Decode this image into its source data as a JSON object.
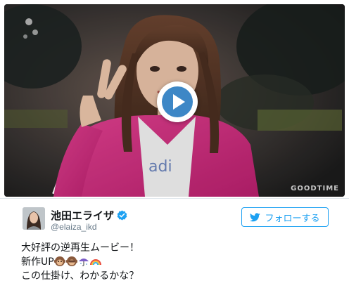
{
  "video": {
    "watermark": "GOODTIME",
    "play_icon": "play-icon"
  },
  "tweet": {
    "display_name": "池田エライザ",
    "verified_icon": "verified-badge-icon",
    "handle": "@elaiza_ikd",
    "follow_label": "フォローする",
    "follow_icon": "twitter-bird-icon",
    "lines": [
      "大好評の逆再生ムービー！",
      "新作UP",
      "この仕掛け、わかるかな？"
    ],
    "line2_emojis": [
      "monkey-face-icon",
      "monkey-face-icon",
      "umbrella-icon",
      "rainbow-icon"
    ]
  },
  "colors": {
    "accent": "#1da1f2",
    "text": "#14171a",
    "muted": "#657786"
  }
}
